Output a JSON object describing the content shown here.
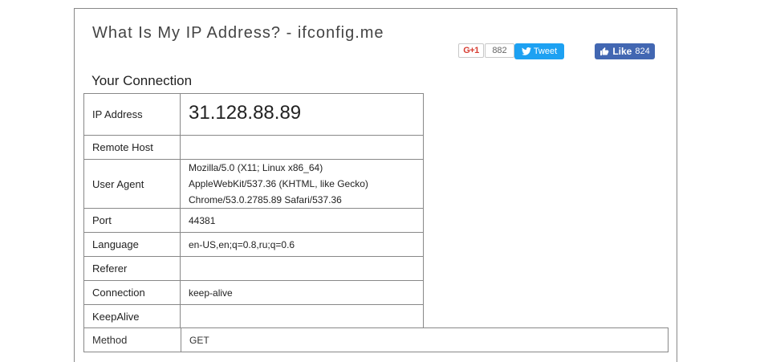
{
  "header": {
    "title": "What Is My IP Address? - ifconfig.me"
  },
  "social": {
    "gplus_label": "G+1",
    "gplus_count": "882",
    "tweet_label": "Tweet",
    "fb_like_label": "Like",
    "fb_like_count": "824",
    "colors": {
      "tweet": "#1da1f2",
      "facebook": "#4267b2",
      "gplus": "#d73d32"
    }
  },
  "section": {
    "heading": "Your Connection"
  },
  "connection": {
    "ip_address": {
      "key": "IP Address",
      "value": "31.128.88.89"
    },
    "remote_host": {
      "key": "Remote Host",
      "value": ""
    },
    "user_agent": {
      "key": "User Agent",
      "lines": [
        "Mozilla/5.0 (X11; Linux x86_64)",
        "AppleWebKit/537.36 (KHTML, like Gecko)",
        "Chrome/53.0.2785.89 Safari/537.36"
      ]
    },
    "port": {
      "key": "Port",
      "value": "44381"
    },
    "language": {
      "key": "Language",
      "value": "en-US,en;q=0.8,ru;q=0.6"
    },
    "referer": {
      "key": "Referer",
      "value": ""
    },
    "connection_type": {
      "key": "Connection",
      "value": "keep-alive"
    },
    "keepalive": {
      "key": "KeepAlive",
      "value": ""
    },
    "method": {
      "key": "Method",
      "value": "GET"
    }
  }
}
